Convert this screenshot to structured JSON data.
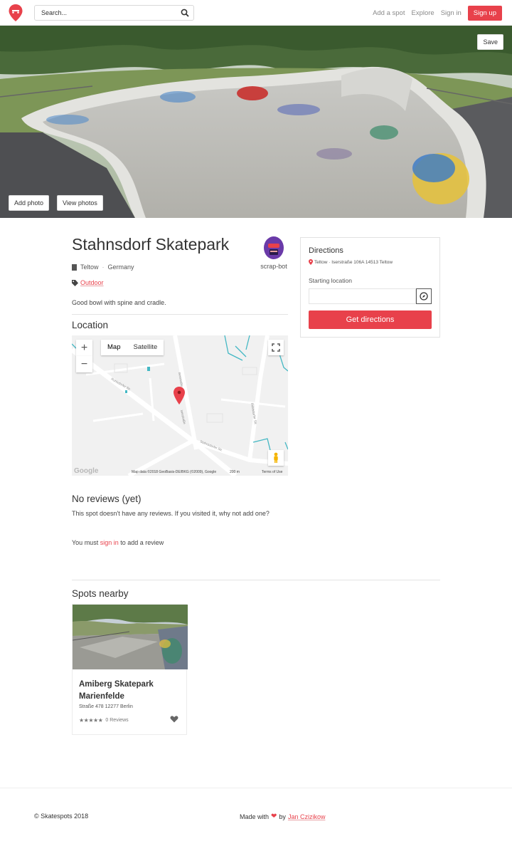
{
  "navbar": {
    "search_placeholder": "Search...",
    "links": [
      "Add a spot",
      "Explore",
      "Sign in"
    ],
    "signup_label": "Sign up",
    "icons": {
      "logo": "skatespots-pin-logo",
      "search": "search-icon"
    }
  },
  "hero": {
    "save_label": "Save",
    "add_photo_label": "Add photo",
    "view_photos_label": "View photos"
  },
  "spot": {
    "title": "Stahnsdorf Skatepark",
    "city": "Teltow",
    "country": "Germany",
    "tag": "Outdoor",
    "description": "Good bowl with spine and cradle.",
    "author": "scrap-bot"
  },
  "location": {
    "heading": "Location",
    "map_label": "Map",
    "satellite_label": "Satellite",
    "zoom_in": "+",
    "zoom_out": "−",
    "google": "Google",
    "attribution": "Map data ©2018 GeoBasis-DE/BKG (©2009), Google",
    "scale": "200 m",
    "terms": "Terms of Use",
    "street_labels": [
      "Iserstraße",
      "Iserstraße",
      "Ruhlsdorfer Str.",
      "Stahnsdorfer Str.",
      "Ruhlsdorfer Str."
    ]
  },
  "reviews": {
    "heading": "No reviews (yet)",
    "empty_text": "This spot doesn't have any reviews. If you visited it, why not add one?",
    "must_prefix": "You must ",
    "sign_in_link": "sign in",
    "must_suffix": " to add a review"
  },
  "nearby": {
    "heading": "Spots nearby",
    "items": [
      {
        "name": "Amiberg Skatepark Marienfelde",
        "address": "Straße 478 12277 Berlin",
        "stars": "★★★★★",
        "reviews": "0 Reviews"
      }
    ]
  },
  "directions": {
    "heading": "Directions",
    "address": "Teltow · Iserstraße 106A 14513 Teltow",
    "starting_label": "Starting location",
    "starting_value": "",
    "button_label": "Get directions"
  },
  "footer": {
    "copyright": "© Skatespots 2018",
    "made_with_prefix": "Made with",
    "made_with_by": "by",
    "author_link": "Jan Czizikow"
  },
  "colors": {
    "accent": "#e8414b",
    "text": "#333333",
    "muted": "#8a8a8a"
  }
}
